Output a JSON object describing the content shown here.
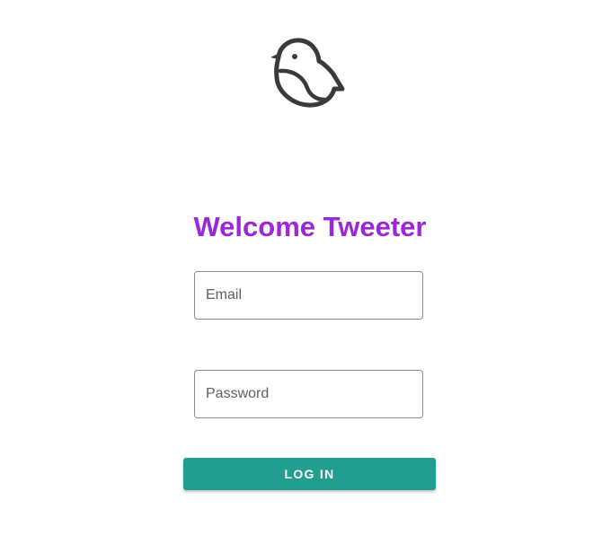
{
  "header": {
    "logo_icon": "bird-icon"
  },
  "login": {
    "title": "Welcome Tweeter",
    "email_placeholder": "Email",
    "password_placeholder": "Password",
    "login_label": "LOG IN"
  },
  "colors": {
    "title": "#9c27d8",
    "button": "#229e90",
    "field_border": "#8a8a8a"
  }
}
